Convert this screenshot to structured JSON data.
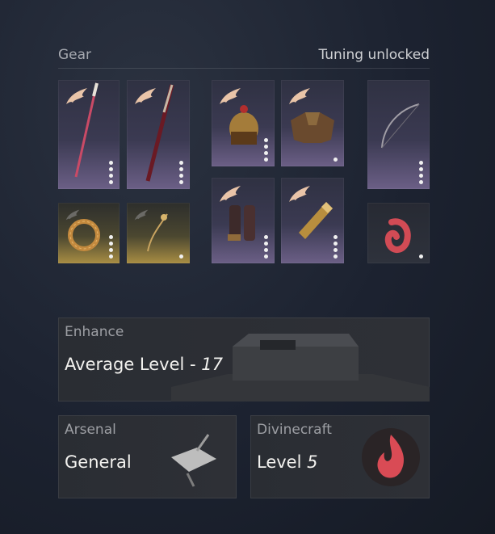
{
  "header": {
    "title": "Gear",
    "status": "Tuning unlocked"
  },
  "gear": {
    "slots": [
      {
        "id": "spear",
        "dots": 4
      },
      {
        "id": "blade",
        "dots": 4
      },
      {
        "id": "helmet",
        "dots": 4
      },
      {
        "id": "armor",
        "dots": 1
      },
      {
        "id": "bow",
        "dots": 4
      },
      {
        "id": "ring",
        "dots": 4
      },
      {
        "id": "pendant",
        "dots": 1
      },
      {
        "id": "greaves",
        "dots": 4
      },
      {
        "id": "bracers",
        "dots": 4
      },
      {
        "id": "ornament",
        "dots": 1
      }
    ],
    "wing_icon": "feather-wing-icon",
    "accent_purple": "#6b5f86",
    "accent_gold": "#a88d43"
  },
  "enhance": {
    "label": "Enhance",
    "value_prefix": "Average Level - ",
    "value_num": "17"
  },
  "arsenal": {
    "label": "Arsenal",
    "value": "General"
  },
  "divinecraft": {
    "label": "Divinecraft",
    "value_prefix": "Level ",
    "value_num": "5",
    "accent": "#d94b55"
  }
}
